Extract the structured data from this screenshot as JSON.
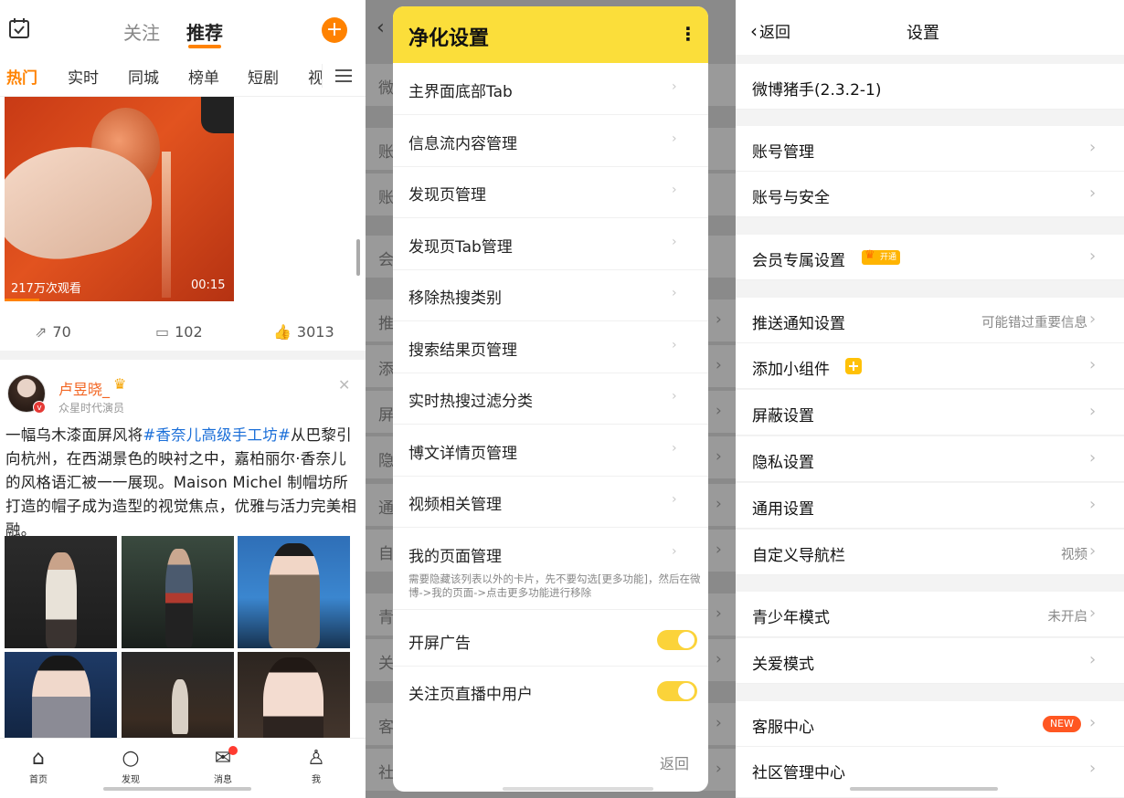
{
  "feed": {
    "top_tabs": [
      "关注",
      "推荐"
    ],
    "active_top_tab": "推荐",
    "categories": [
      "热门",
      "实时",
      "同城",
      "榜单",
      "短剧",
      "视"
    ],
    "video": {
      "views": "217万次观看",
      "duration": "00:15"
    },
    "actions": {
      "repost": "70",
      "comment": "102",
      "like": "3013"
    },
    "post": {
      "author": "卢昱晓_",
      "author_sub": "众星时代演员",
      "text_before": "一幅乌木漆面屏风将",
      "hashtag": "#香奈儿高级手工坊#",
      "text_after": "从巴黎引向杭州，在西湖景色的映衬之中，嘉柏丽尔·香奈儿的风格语汇被一一展现。Maison Michel 制帽坊所打造的帽子成为造型的视觉焦点，优雅与活力完美相融。"
    },
    "nav": [
      "首页",
      "发现",
      "消息",
      "我"
    ]
  },
  "dialog": {
    "title": "净化设置",
    "items": [
      "主界面底部Tab",
      "信息流内容管理",
      "发现页管理",
      "发现页Tab管理",
      "移除热搜类别",
      "搜索结果页管理",
      "实时热搜过滤分类",
      "博文详情页管理",
      "视频相关管理",
      "我的页面管理"
    ],
    "note": "需要隐藏该列表以外的卡片，先不要勾选[更多功能]，然后在微博->我的页面->点击更多功能进行移除",
    "toggles": [
      {
        "label": "开屏广告",
        "on": true
      },
      {
        "label": "关注页直播中用户",
        "on": true
      }
    ],
    "back": "返回",
    "bg_rows": [
      "微",
      "账",
      "账",
      "会",
      "推",
      "添",
      "屏",
      "隐",
      "通",
      "自",
      "青",
      "关",
      "客",
      "社"
    ]
  },
  "settings": {
    "back": "返回",
    "title": "设置",
    "version": "微博猪手(2.3.2-1)",
    "rows": [
      {
        "label": "账号管理",
        "value": ""
      },
      {
        "label": "账号与安全",
        "value": ""
      },
      {
        "label": "会员专属设置",
        "value": "",
        "badge": "开通"
      },
      {
        "label": "推送通知设置",
        "value": "可能错过重要信息"
      },
      {
        "label": "添加小组件",
        "value": ""
      },
      {
        "label": "屏蔽设置",
        "value": ""
      },
      {
        "label": "隐私设置",
        "value": ""
      },
      {
        "label": "通用设置",
        "value": ""
      },
      {
        "label": "自定义导航栏",
        "value": "视频"
      },
      {
        "label": "青少年模式",
        "value": "未开启"
      },
      {
        "label": "关爱模式",
        "value": ""
      },
      {
        "label": "客服中心",
        "value": "",
        "badge": "NEW"
      },
      {
        "label": "社区管理中心",
        "value": ""
      }
    ]
  },
  "colors": {
    "accent": "#ff8200",
    "dialog_header": "#fbde3a",
    "toggle_on": "#fbd33a",
    "hashtag": "#1a6ed8"
  },
  "icons": [
    "calendar-check-icon",
    "plus-icon",
    "menu-icon",
    "repost-icon",
    "comment-icon",
    "like-icon",
    "close-icon",
    "home-icon",
    "discover-icon",
    "message-icon",
    "profile-icon",
    "more-vertical-icon",
    "chevron-right-icon",
    "chevron-left-icon",
    "crown-icon",
    "widget-icon"
  ]
}
